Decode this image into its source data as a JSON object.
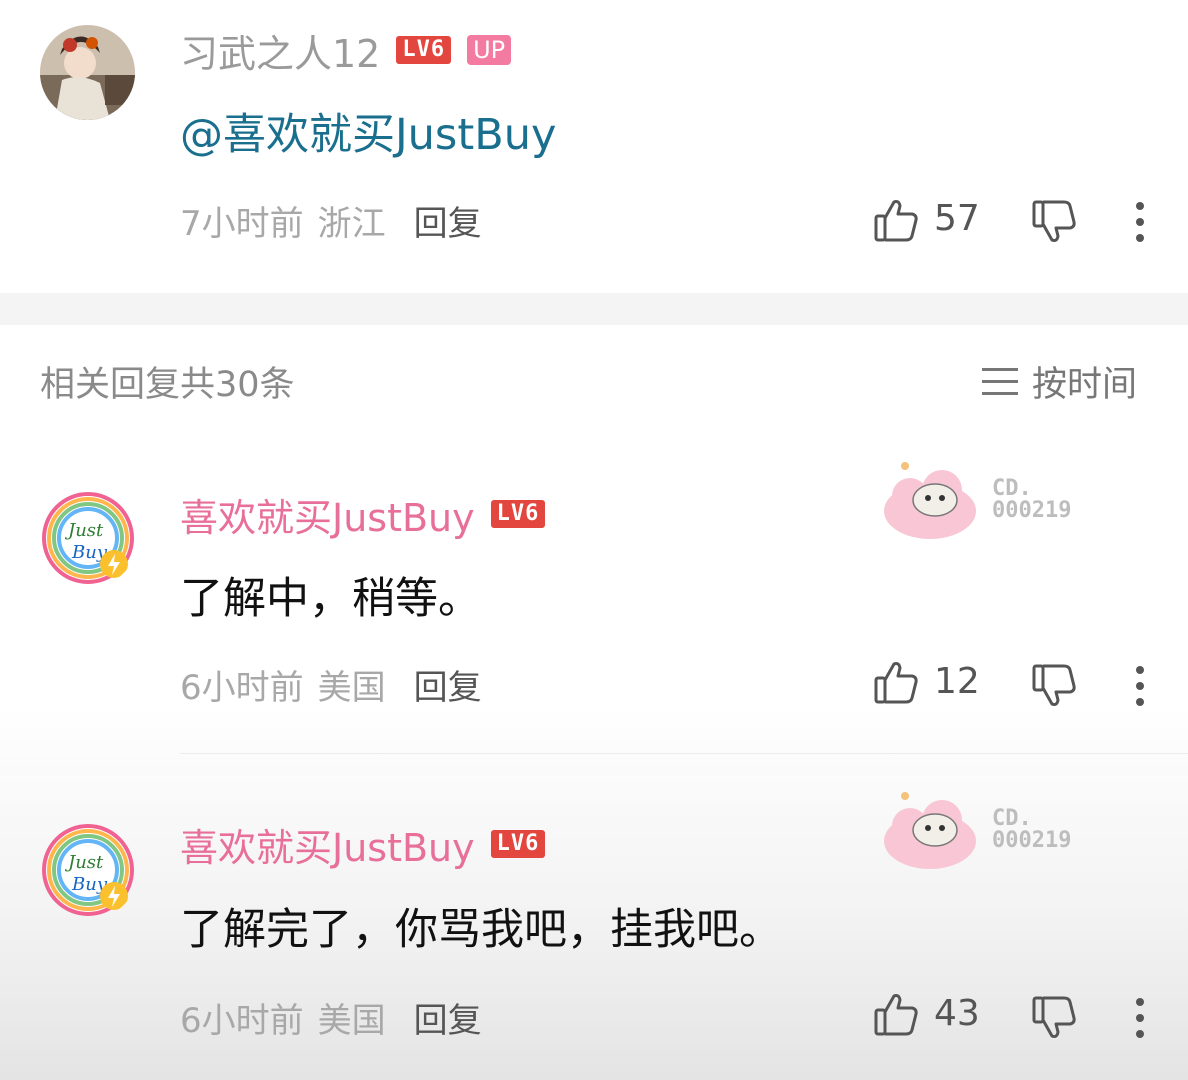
{
  "main_comment": {
    "username": "习武之人12",
    "level_badge": "LV6",
    "up_badge": "UP",
    "text": "@喜欢就买JustBuy",
    "time": "7小时前",
    "location": "浙江",
    "reply_label": "回复",
    "like_count": "57"
  },
  "replies_section": {
    "title": "相关回复共30条",
    "sort_label": "按时间"
  },
  "replies": [
    {
      "username": "喜欢就买JustBuy",
      "level_badge": "LV6",
      "text": "了解中，稍等。",
      "time": "6小时前",
      "location": "美国",
      "reply_label": "回复",
      "like_count": "12",
      "fan_card_line1": "CD.",
      "fan_card_line2": "000219"
    },
    {
      "username": "喜欢就买JustBuy",
      "level_badge": "LV6",
      "text": "了解完了，你骂我吧，挂我吧。",
      "time": "6小时前",
      "location": "美国",
      "reply_label": "回复",
      "like_count": "43",
      "fan_card_line1": "CD.",
      "fan_card_line2": "000219"
    }
  ],
  "colors": {
    "username_reply": "#e86f9a",
    "mention": "#1a6f8e",
    "level_badge": "#e3463e",
    "up_badge": "#f37aa0"
  },
  "icons": [
    "thumbs-up-icon",
    "thumbs-down-icon",
    "more-vertical-icon",
    "sort-lines-icon"
  ]
}
